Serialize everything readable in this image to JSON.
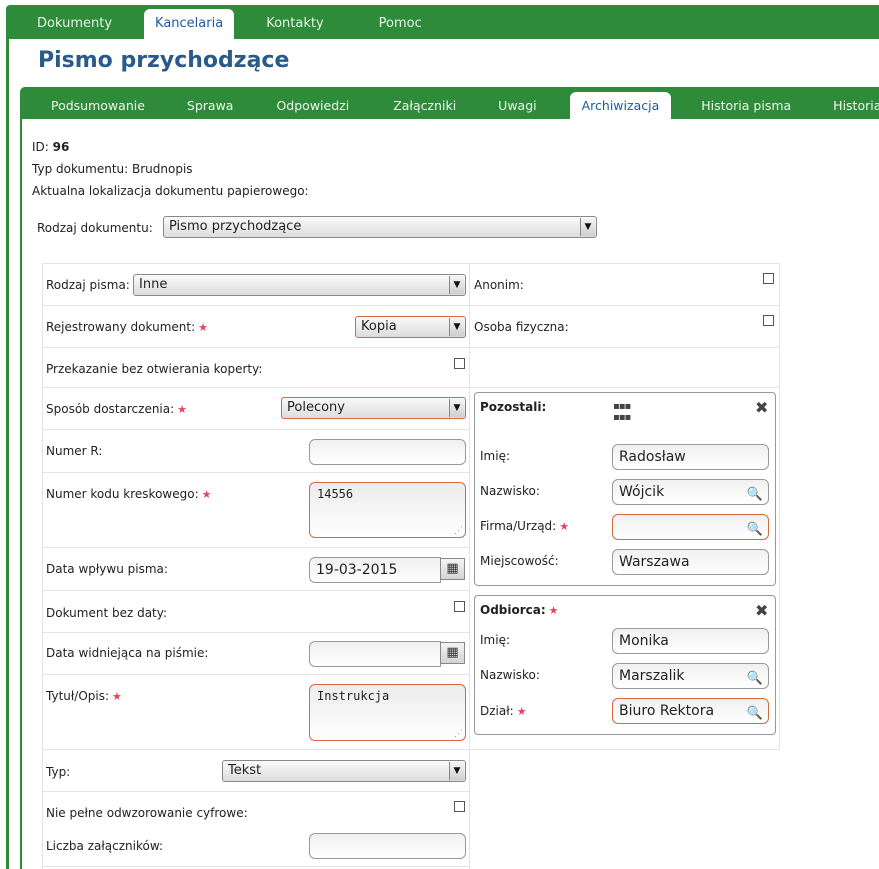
{
  "top_tabs": [
    "Dokumenty",
    "Kancelaria",
    "Kontakty",
    "Pomoc"
  ],
  "page_title": "Pismo przychodzące",
  "sub_tabs": [
    "Podsumowanie",
    "Sprawa",
    "Odpowiedzi",
    "Załączniki",
    "Uwagi",
    "Archiwizacja",
    "Historia pisma",
    "Historia dekr"
  ],
  "info": {
    "id_label": "ID:",
    "id_value": "96",
    "typ_label": "Typ dokumentu:",
    "typ_value": "Brudnopis",
    "lokalizacja_label": "Aktualna lokalizacja dokumentu papierowego:"
  },
  "rodzaj_dokumentu": {
    "label": "Rodzaj dokumentu:",
    "value": "Pismo przychodzące"
  },
  "form": {
    "rodzaj_pisma": {
      "label": "Rodzaj pisma:",
      "value": "Inne"
    },
    "rejestrowany": {
      "label": "Rejestrowany dokument:",
      "value": "Kopia"
    },
    "przekazanie": {
      "label": "Przekazanie bez otwierania koperty:"
    },
    "sposob": {
      "label": "Sposób dostarczenia:",
      "value": "Polecony"
    },
    "numer_r": {
      "label": "Numer R:",
      "value": ""
    },
    "kod": {
      "label": "Numer kodu kreskowego:",
      "value": "14556"
    },
    "data_wplywu": {
      "label": "Data wpływu pisma:",
      "value": "19-03-2015"
    },
    "bez_daty": {
      "label": "Dokument bez daty:"
    },
    "data_na_pismie": {
      "label": "Data widniejąca na piśmie:",
      "value": ""
    },
    "tytul": {
      "label": "Tytuł/Opis:",
      "value": "Instrukcja"
    },
    "typ": {
      "label": "Typ:",
      "value": "Tekst"
    },
    "niepelne": {
      "label": "Nie pełne odwzorowanie cyfrowe:"
    },
    "liczba": {
      "label": "Liczba załączników:",
      "value": ""
    }
  },
  "right": {
    "anonim": "Anonim:",
    "osoba_fizyczna": "Osoba fizyczna:"
  },
  "pozostali": {
    "title": "Pozostali:",
    "imie_label": "Imię:",
    "imie": "Radosław",
    "nazwisko_label": "Nazwisko:",
    "nazwisko": "Wójcik",
    "firma_label": "Firma/Urząd:",
    "firma": "",
    "miejscowosc_label": "Miejscowość:",
    "miejscowosc": "Warszawa"
  },
  "odbiorca": {
    "title": "Odbiorca:",
    "imie_label": "Imię:",
    "imie": "Monika",
    "nazwisko_label": "Nazwisko:",
    "nazwisko": "Marszalik",
    "dzial_label": "Dział:",
    "dzial": "Biuro Rektora"
  },
  "icons": {
    "required": "star-icon",
    "search": "magnifier-icon",
    "calendar": "calendar-icon",
    "close": "close-icon",
    "grid": "grid-icon"
  }
}
